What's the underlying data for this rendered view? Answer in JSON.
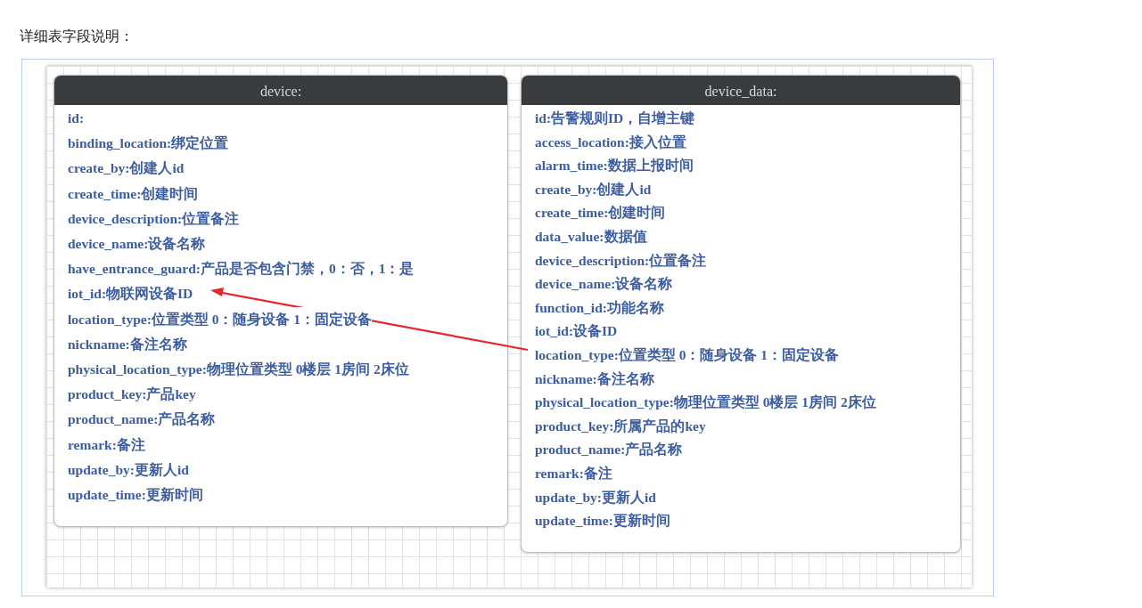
{
  "heading": "详细表字段说明：",
  "tables": [
    {
      "title": "device:",
      "fields": [
        "id:",
        "binding_location:绑定位置",
        "create_by:创建人id",
        "create_time:创建时间",
        "device_description:位置备注",
        "device_name:设备名称",
        "have_entrance_guard:产品是否包含门禁，0：否，1：是",
        "iot_id:物联网设备ID",
        "location_type:位置类型 0：随身设备 1：固定设备",
        "nickname:备注名称",
        "physical_location_type:物理位置类型 0楼层 1房间 2床位",
        "product_key:产品key",
        "product_name:产品名称",
        "remark:备注",
        "update_by:更新人id",
        "update_time:更新时间"
      ]
    },
    {
      "title": "device_data:",
      "fields": [
        "id:告警规则ID，自增主键",
        "access_location:接入位置",
        "alarm_time:数据上报时间",
        "create_by:创建人id",
        "create_time:创建时间",
        "data_value:数据值",
        "device_description:位置备注",
        "device_name:设备名称",
        "function_id:功能名称",
        "iot_id:设备ID",
        "location_type:位置类型 0：随身设备 1：固定设备",
        "nickname:备注名称",
        "physical_location_type:物理位置类型 0楼层 1房间 2床位",
        "product_key:所属产品的key",
        "product_name:产品名称",
        "remark:备注",
        "update_by:更新人id",
        "update_time:更新时间"
      ]
    }
  ]
}
